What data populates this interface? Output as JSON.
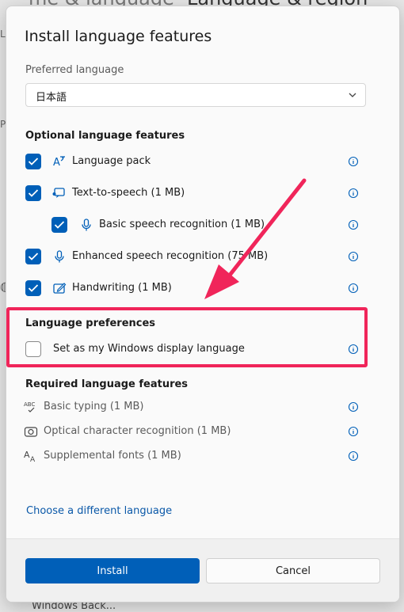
{
  "background": {
    "left_title": "me & language",
    "right_title": "Language & region",
    "footer_text": "Windows Back..."
  },
  "dialog": {
    "title": "Install language features",
    "preferred_language": {
      "label": "Preferred language",
      "value": "日本語"
    },
    "optional_features": {
      "heading": "Optional language features",
      "items": [
        {
          "label": "Language pack",
          "icon": "language-pack-icon",
          "checked": true
        },
        {
          "label": "Text-to-speech (1 MB)",
          "icon": "text-to-speech-icon",
          "checked": true
        },
        {
          "label": "Basic speech recognition (1 MB)",
          "icon": "microphone-icon",
          "checked": true
        },
        {
          "label": "Enhanced speech recognition (75 MB)",
          "icon": "microphone-icon",
          "checked": true
        },
        {
          "label": "Handwriting (1 MB)",
          "icon": "handwriting-icon",
          "checked": true
        }
      ]
    },
    "preferences": {
      "heading": "Language preferences",
      "display_language": {
        "label": "Set as my Windows display language",
        "checked": false
      }
    },
    "required_features": {
      "heading": "Required language features",
      "items": [
        {
          "label": "Basic typing (1 MB)",
          "icon": "basic-typing-icon"
        },
        {
          "label": "Optical character recognition (1 MB)",
          "icon": "ocr-icon"
        },
        {
          "label": "Supplemental fonts (1 MB)",
          "icon": "fonts-icon"
        }
      ]
    },
    "choose_link": "Choose a different language",
    "buttons": {
      "install": "Install",
      "cancel": "Cancel"
    }
  },
  "colors": {
    "accent": "#005fb8",
    "annotation": "#f0255a",
    "link": "#0a58a8"
  }
}
